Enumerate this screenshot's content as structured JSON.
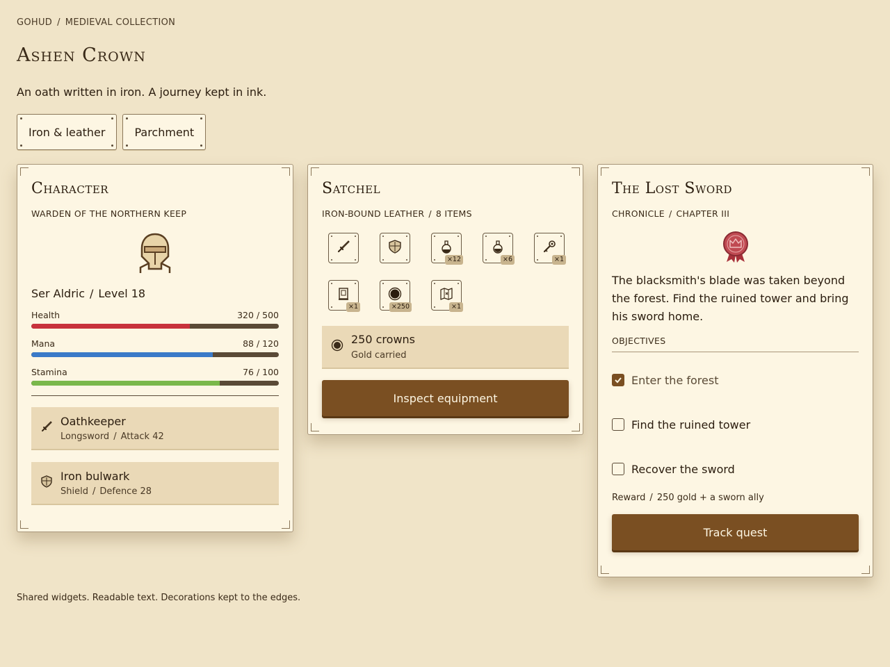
{
  "breadcrumb": {
    "root": "GOHUD",
    "current": "MEDIEVAL COLLECTION",
    "separator": "/"
  },
  "title": "Ashen Crown",
  "tagline": "An oath written in iron. A journey kept in ink.",
  "themes": [
    {
      "label": "Iron & leather"
    },
    {
      "label": "Parchment"
    }
  ],
  "character": {
    "title": "Character",
    "subtitle": "WARDEN OF THE NORTHERN KEEP",
    "portrait_icon": "knight-helm-icon",
    "name": "Ser Aldric",
    "level": "Level 18",
    "stats": [
      {
        "label": "Health",
        "value": "320 / 500",
        "fraction": 0.64,
        "color": "#c8323c"
      },
      {
        "label": "Mana",
        "value": "88 / 120",
        "fraction": 0.733,
        "color": "#3a7ac8"
      },
      {
        "label": "Stamina",
        "value": "76 / 100",
        "fraction": 0.76,
        "color": "#7ab84a"
      }
    ],
    "equipment": [
      {
        "name": "Oathkeeper",
        "type": "Longsword",
        "stat": "Attack 42",
        "icon": "sword-icon"
      },
      {
        "name": "Iron bulwark",
        "type": "Shield",
        "stat": "Defence 28",
        "icon": "shield-icon"
      }
    ]
  },
  "satchel": {
    "title": "Satchel",
    "subtitle_a": "IRON-BOUND LEATHER",
    "subtitle_b": "8 ITEMS",
    "items": [
      {
        "icon": "sword-icon",
        "count": ""
      },
      {
        "icon": "shield-icon",
        "count": ""
      },
      {
        "icon": "red-potion-icon",
        "count": "×12"
      },
      {
        "icon": "blue-potion-icon",
        "count": "×6"
      },
      {
        "icon": "key-icon",
        "count": "×1"
      },
      {
        "icon": "scroll-icon",
        "count": "×1"
      },
      {
        "icon": "coin-icon",
        "count": "×250"
      },
      {
        "icon": "map-icon",
        "count": "×1"
      }
    ],
    "gold_amount": "250 crowns",
    "gold_label": "Gold carried",
    "action": "Inspect equipment"
  },
  "quest": {
    "title": "The Lost Sword",
    "subtitle_a": "CHRONICLE",
    "subtitle_b": "CHAPTER III",
    "seal_icon": "wax-seal-icon",
    "description": "The blacksmith's blade was taken beyond the forest. Find the ruined tower and bring his sword home.",
    "objectives_heading": "OBJECTIVES",
    "objectives": [
      {
        "label": "Enter the forest",
        "done": true
      },
      {
        "label": "Find the ruined tower",
        "done": false
      },
      {
        "label": "Recover the sword",
        "done": false
      }
    ],
    "reward_label": "Reward",
    "reward_value": "250 gold + a sworn ally",
    "action": "Track quest"
  },
  "footer": "Shared widgets. Readable text. Decorations kept to the edges.",
  "colors": {
    "background": "#f0e4c8",
    "card": "#fdf6e3",
    "accent": "#7a4f22"
  }
}
